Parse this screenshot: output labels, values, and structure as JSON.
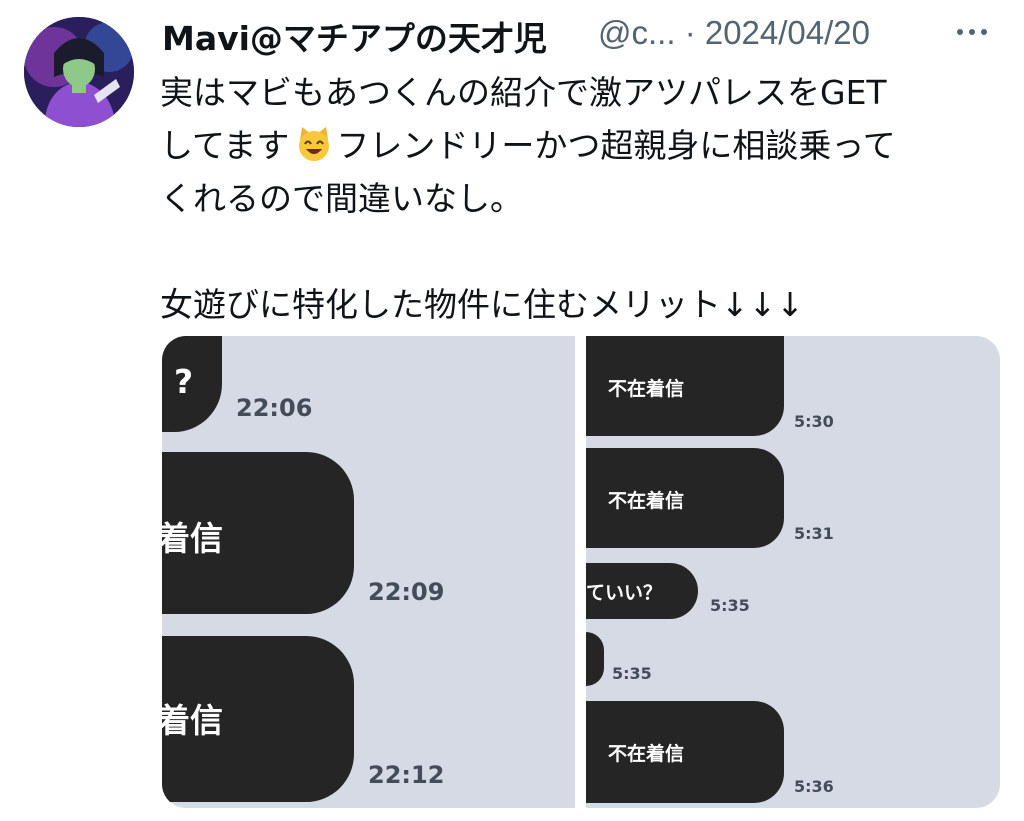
{
  "tweet": {
    "author": {
      "display_name": "Mavi@マチアプの天才児",
      "handle_truncated": "@c...",
      "date": "· 2024/04/20"
    },
    "more_icon": "more-dots-icon",
    "text_lines": [
      "実はマビもあつくんの紹介で激アツパレスをGET",
      "してます",
      "フレンドリーかつ超親身に相談乗って",
      "くれるので間違いなし。",
      "女遊びに特化した物件に住むメリット↓↓↓"
    ],
    "emoji": "smiling-cat-emoji"
  },
  "media": {
    "left_panel": {
      "bubbles": [
        {
          "text": "?",
          "time": "22:06"
        },
        {
          "text": "着信",
          "time": "22:09"
        },
        {
          "text": "着信",
          "time": "22:12"
        }
      ]
    },
    "right_panel": {
      "bubbles": [
        {
          "text": "不在着信",
          "time": "5:30"
        },
        {
          "text": "不在着信",
          "time": "5:31"
        },
        {
          "text": "ていい？",
          "time": "5:35"
        },
        {
          "text": "",
          "time": "5:35"
        },
        {
          "text": "不在着信",
          "time": "5:36"
        }
      ]
    }
  },
  "colors": {
    "text": "#0f1419",
    "secondary_text": "#536471",
    "chat_background": "#d6dae5",
    "bubble": "#252525"
  }
}
